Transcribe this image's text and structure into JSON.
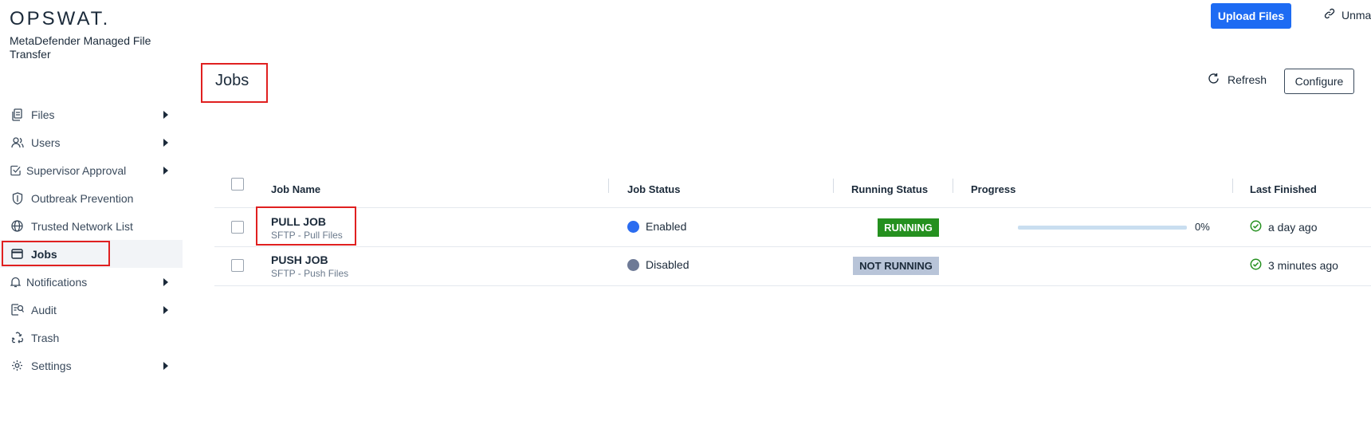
{
  "brand": {
    "logo": "OPSWAT.",
    "product": "MetaDefender Managed File Transfer"
  },
  "sidebar": {
    "items": [
      {
        "label": "Files",
        "icon": "files-icon",
        "has_submenu": true
      },
      {
        "label": "Users",
        "icon": "users-icon",
        "has_submenu": true
      },
      {
        "label": "Supervisor Approval",
        "icon": "approval-icon",
        "has_submenu": true
      },
      {
        "label": "Outbreak Prevention",
        "icon": "shield-icon",
        "has_submenu": false
      },
      {
        "label": "Trusted Network List",
        "icon": "globe-icon",
        "has_submenu": false
      },
      {
        "label": "Jobs",
        "icon": "jobs-icon",
        "has_submenu": false,
        "active": true
      },
      {
        "label": "Notifications",
        "icon": "bell-icon",
        "has_submenu": true
      },
      {
        "label": "Audit",
        "icon": "audit-icon",
        "has_submenu": true
      },
      {
        "label": "Trash",
        "icon": "recycle-icon",
        "has_submenu": false
      },
      {
        "label": "Settings",
        "icon": "gear-icon",
        "has_submenu": true
      }
    ]
  },
  "header": {
    "upload_label": "Upload Files",
    "unmanaged_label": "Unma",
    "page_title": "Jobs",
    "refresh_label": "Refresh",
    "configure_label": "Configure"
  },
  "table": {
    "columns": [
      "Job Name",
      "Job Status",
      "Running Status",
      "Progress",
      "Last Finished"
    ],
    "rows": [
      {
        "name": "PULL JOB",
        "subtitle": "SFTP - Pull Files",
        "status": "Enabled",
        "status_color": "#2b6cf0",
        "running": "RUNNING",
        "running_bg": "#25901f",
        "running_fg": "#ffffff",
        "progress": 0,
        "progress_label": "0%",
        "last_finished": "a day ago"
      },
      {
        "name": "PUSH JOB",
        "subtitle": "SFTP - Push Files",
        "status": "Disabled",
        "status_color": "#6e7a96",
        "running": "NOT RUNNING",
        "running_bg": "#b8c4d8",
        "running_fg": "#1b2a3a",
        "progress": null,
        "progress_label": "",
        "last_finished": "3 minutes ago"
      }
    ]
  },
  "colors": {
    "accent": "#1d6bf3",
    "highlight": "#e02020",
    "success": "#25901f"
  }
}
